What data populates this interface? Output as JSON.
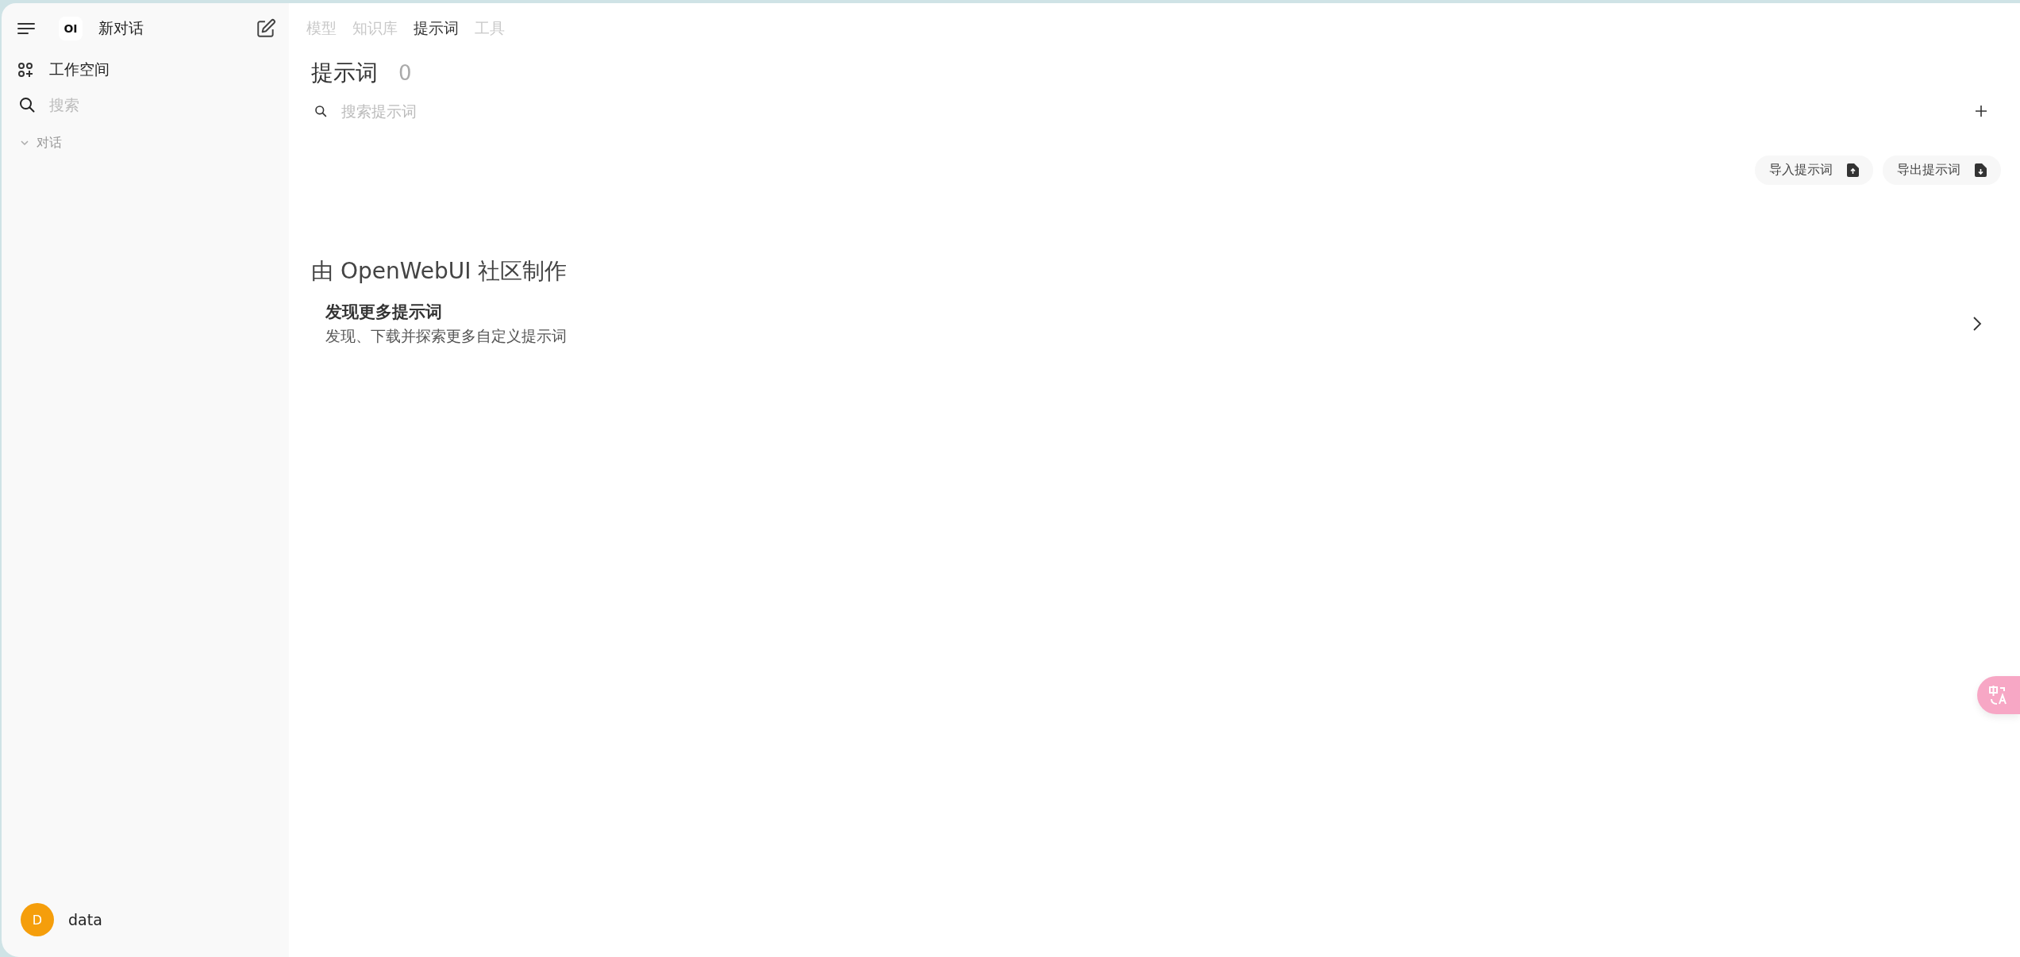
{
  "sidebar": {
    "logo": "OI",
    "new_chat": "新对话",
    "workspace": "工作空间",
    "search": {
      "placeholder": "搜索"
    },
    "section": {
      "label": "对话",
      "expanded": true
    },
    "user": {
      "initial": "D",
      "name": "data",
      "color": "#f59e0b"
    }
  },
  "tabs": [
    {
      "label": "模型",
      "selected": false
    },
    {
      "label": "知识库",
      "selected": false
    },
    {
      "label": "提示词",
      "selected": true
    },
    {
      "label": "工具",
      "selected": false
    }
  ],
  "header": {
    "title": "提示词",
    "count": "0"
  },
  "search": {
    "placeholder": "搜索提示词"
  },
  "actions": [
    "导入提示词",
    "导出提示词"
  ],
  "community": {
    "heading": "由 OpenWebUI 社区制作",
    "title": "发现更多提示词",
    "description": "发现、下载并探索更多自定义提示词"
  }
}
